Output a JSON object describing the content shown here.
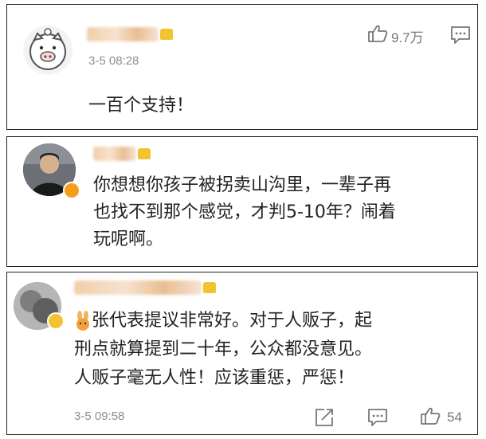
{
  "comments": [
    {
      "time": "3-5 08:28",
      "text": "一百个支持！",
      "likes": "9.7万",
      "avatar_icon": "pig-face-icon"
    },
    {
      "text_lines": [
        "你想想你孩子被拐卖山沟里，一辈子再",
        "也找不到那个感觉，才判5-10年？闹着",
        "玩呢啊。"
      ],
      "avatar_icon": "user-photo-avatar",
      "verified_badge": "verified-v-icon"
    },
    {
      "time": "3-5 09:58",
      "text_lines": [
        "张代表提议非常好。对于人贩子，起",
        "刑点就算提到二十年，公众都没意见。",
        "人贩子毫无人性！应该重惩，严惩！"
      ],
      "likes": "54",
      "avatar_icon": "user-photo-avatar"
    }
  ],
  "colors": {
    "border": "#222222",
    "muted": "#8e8e8e",
    "accent": "#f59d1a"
  }
}
